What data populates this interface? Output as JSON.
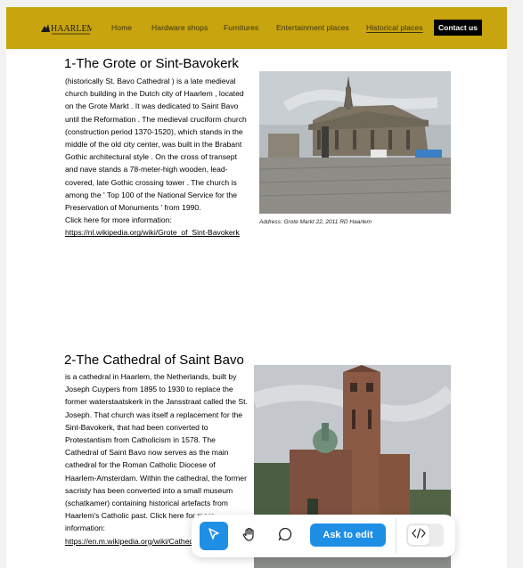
{
  "colors": {
    "navbar": "#c8a40f",
    "contact_bg": "#000000",
    "accent": "#1f8fe5"
  },
  "nav": {
    "logo_text": "HAARLEM",
    "items": [
      {
        "label": "Home"
      },
      {
        "label": "Hardware shops"
      },
      {
        "label": "Furnitures"
      },
      {
        "label": "Entertainment places"
      },
      {
        "label": "Historical places",
        "active": true
      }
    ],
    "contact_label": "Contact us"
  },
  "sections": [
    {
      "heading": "1-The Grote or Sint-Bavokerk",
      "description": "(historically St. Bavo Cathedral ) is a late medieval church building in the Dutch city of Haarlem , located on the Grote Markt . It was dedicated to Saint Bavo until the Reformation . The medieval cruciform church (construction period 1370-1520), which stands in the middle of the old city center, was built in the Brabant Gothic architectural style . On the cross of transept and nave stands a 78-meter-high wooden, lead-covered, late Gothic crossing tower . The church is among the ' Top 100 of the National Service for the Preservation of Monuments ' from 1990.",
      "link_prefix": "Click here for more information: ",
      "link_text": "https://nl.wikipedia.org/wiki/Grote_of_Sint-Bavokerk",
      "image_icon": "church-photo",
      "caption": "Address: Grote Markt 22, 2011 RD Haarlem"
    },
    {
      "heading": "2-The Cathedral of Saint Bavo",
      "description": "is a cathedral in Haarlem, the Netherlands, built by Joseph Cuypers from 1895 to 1930 to replace the former waterstaatskerk in the Jansstraat called the St. Joseph. That church was itself a replacement for the Sint-Bavokerk, that had been converted to Protestantism from Catholicism in 1578. The Cathedral of Saint Bavo now serves as the main cathedral for the Roman Catholic Diocese of Haarlem-Amsterdam. Within the cathedral, the former sacristy has been converted into a small museum (schatkamer) containing historical artefacts from Haarlem's Catholic past. Click here for more information: ",
      "link_text": "https://en.m.wikipedia.org/wiki/Cathedral_of_St_Bavo,_Haarlem",
      "image_icon": "cathedral-photo"
    }
  ],
  "toolbar": {
    "tools": [
      "cursor-icon",
      "hand-icon",
      "comment-icon"
    ],
    "ask_label": "Ask to edit",
    "code_icon": "code-icon"
  }
}
